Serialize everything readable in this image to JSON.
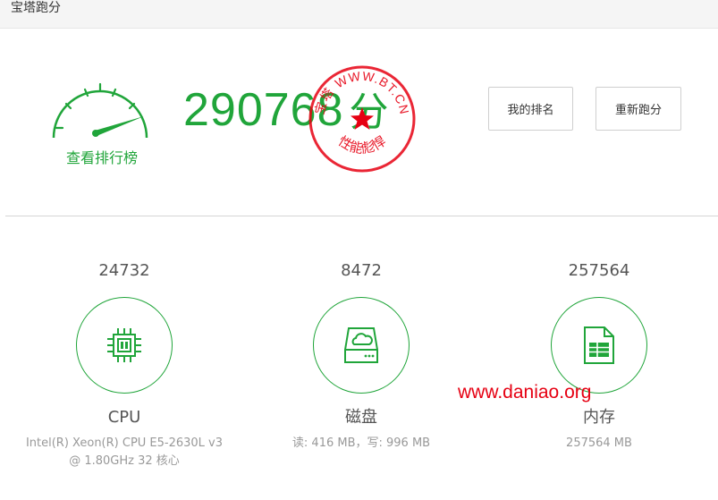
{
  "window": {
    "title": "宝塔跑分"
  },
  "score": {
    "value": "290768",
    "unit": "分",
    "rank_link": "查看排行榜"
  },
  "stamp": {
    "top_text": "宝塔 WWW.BT.CN",
    "bottom_text": "性能彪悍",
    "color": "#e60012"
  },
  "buttons": {
    "my_rank": "我的排名",
    "retest": "重新跑分"
  },
  "metrics": [
    {
      "value": "24732",
      "label": "CPU",
      "detail": "Intel(R) Xeon(R) CPU E5-2630L v3 @ 1.80GHz 32 核心",
      "icon": "cpu-icon"
    },
    {
      "value": "8472",
      "label": "磁盘",
      "detail": "读: 416 MB，写: 996 MB",
      "icon": "disk-icon"
    },
    {
      "value": "257564",
      "label": "内存",
      "detail": "257564 MB",
      "icon": "memory-icon"
    }
  ],
  "watermark": {
    "text": "www.daniao.org",
    "color": "#e60012"
  },
  "colors": {
    "accent": "#20a53a"
  }
}
